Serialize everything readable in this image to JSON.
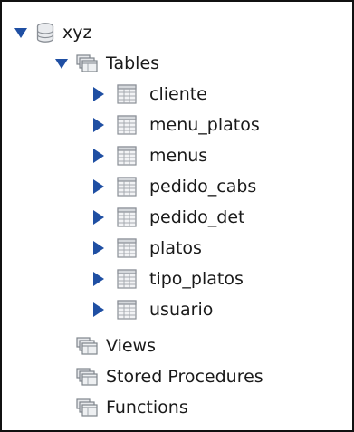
{
  "tree": {
    "database": {
      "label": "xyz",
      "icon": "database-icon",
      "expanded": true
    },
    "tables_folder": {
      "label": "Tables",
      "icon": "folder-icon",
      "expanded": true
    },
    "tables": [
      {
        "label": "cliente"
      },
      {
        "label": "menu_platos"
      },
      {
        "label": "menus"
      },
      {
        "label": "pedido_cabs"
      },
      {
        "label": "pedido_det"
      },
      {
        "label": "platos"
      },
      {
        "label": "tipo_platos"
      },
      {
        "label": "usuario"
      }
    ],
    "other_folders": [
      {
        "label": "Views"
      },
      {
        "label": "Stored Procedures"
      },
      {
        "label": "Functions"
      }
    ]
  },
  "colors": {
    "arrow": "#1f4fa3",
    "icon_gray": "#8a8f96",
    "border": "#111111"
  }
}
